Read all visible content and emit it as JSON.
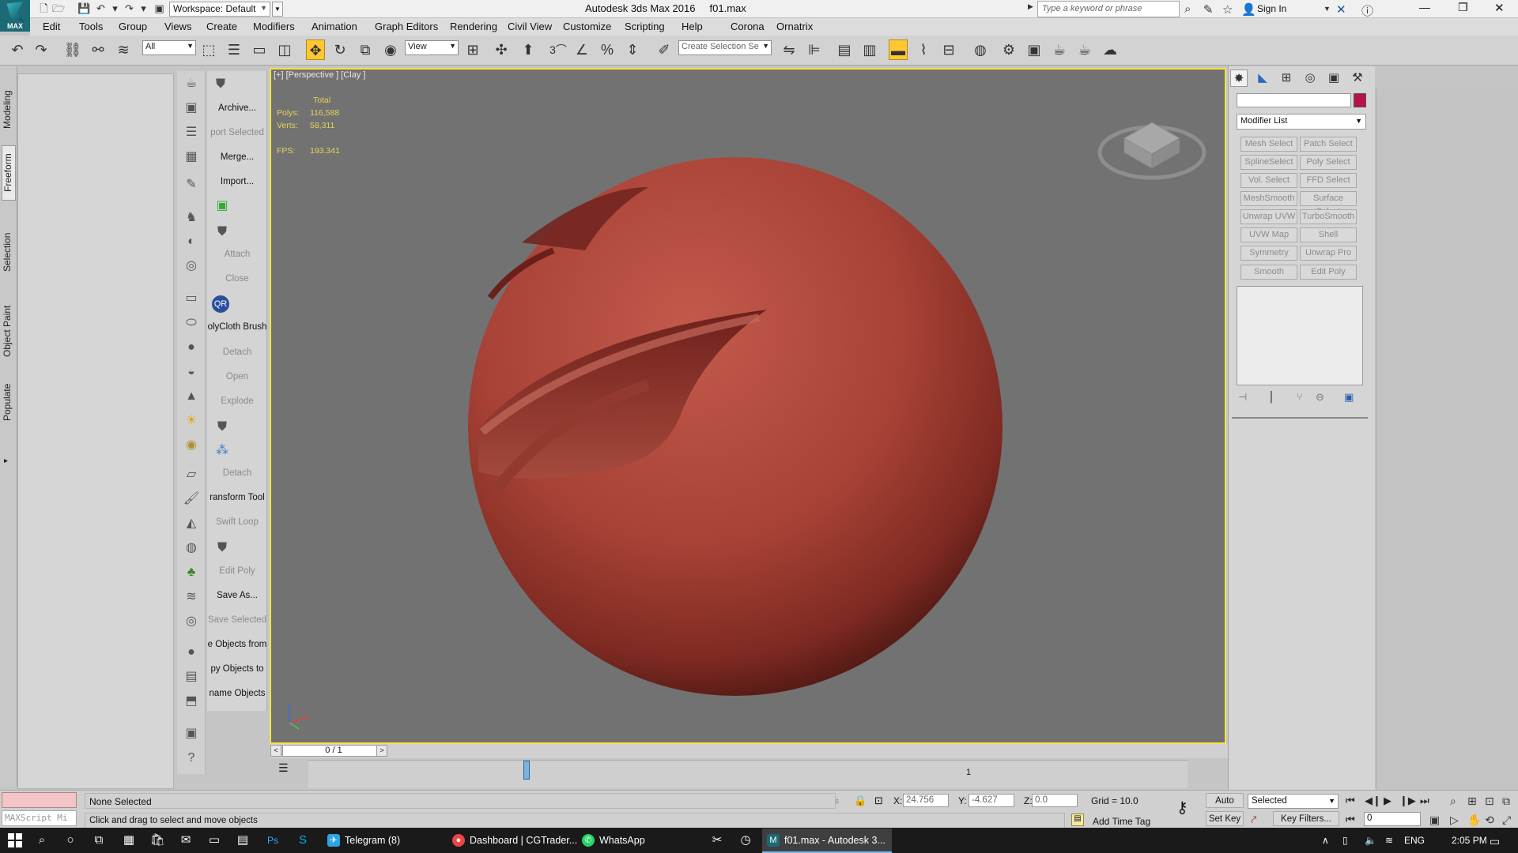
{
  "titlebar": {
    "logo_label": "MAX",
    "workspace": "Workspace: Default",
    "app_name": "Autodesk 3ds Max 2016",
    "file_name": "f01.max",
    "search_placeholder": "Type a keyword or phrase",
    "signin": "Sign In"
  },
  "menu": [
    "Edit",
    "Tools",
    "Group",
    "Views",
    "Create",
    "Modifiers",
    "Animation",
    "Graph Editors",
    "Rendering",
    "Civil View",
    "Customize",
    "Scripting",
    "Help",
    "Corona",
    "Ornatrix"
  ],
  "toolbar": {
    "filter": "All",
    "ref_coord": "View",
    "selection_set_placeholder": "Create Selection Se",
    "snap_label": "3"
  },
  "ribbon_tabs": [
    "Modeling",
    "Freeform",
    "Selection",
    "Object Paint",
    "Populate"
  ],
  "cmd_labels": [
    {
      "text": "Archive...",
      "enabled": true
    },
    {
      "text": "port Selected",
      "enabled": false
    },
    {
      "text": "Merge...",
      "enabled": true
    },
    {
      "text": "Import...",
      "enabled": true
    },
    {
      "text": "Attach",
      "enabled": false
    },
    {
      "text": "Close",
      "enabled": false
    },
    {
      "text": "olyCloth Brush",
      "enabled": true
    },
    {
      "text": "Detach",
      "enabled": false
    },
    {
      "text": "Open",
      "enabled": false
    },
    {
      "text": "Explode",
      "enabled": false
    },
    {
      "text": "Detach",
      "enabled": false
    },
    {
      "text": "ransform Tool",
      "enabled": true
    },
    {
      "text": "Swift Loop",
      "enabled": false
    },
    {
      "text": "Edit Poly",
      "enabled": false
    },
    {
      "text": "Save As...",
      "enabled": true
    },
    {
      "text": "Save Selected",
      "enabled": false
    },
    {
      "text": "e Objects from",
      "enabled": true
    },
    {
      "text": "py Objects to",
      "enabled": true
    },
    {
      "text": "name Objects",
      "enabled": true
    }
  ],
  "viewport": {
    "label": "[+] [Perspective ] [Clay ]",
    "stats_total": "Total",
    "polys_label": "Polys:",
    "polys": "116,588",
    "verts_label": "Verts:",
    "verts": "58,311",
    "fps_label": "FPS:",
    "fps": "193.341",
    "sphere_color": "#b04a3e"
  },
  "timeline": {
    "frame": "0 / 1",
    "track_tick": "1"
  },
  "command_panel": {
    "modifier_list": "Modifier List",
    "object_color": "#b8124a",
    "modifiers": [
      [
        "Mesh Select",
        "Patch Select"
      ],
      [
        "SplineSelect",
        "Poly Select"
      ],
      [
        "Vol. Select",
        "FFD Select"
      ],
      [
        "MeshSmooth",
        "Surface Select"
      ],
      [
        "Unwrap UVW",
        "TurboSmooth"
      ],
      [
        "UVW Map",
        "Shell"
      ],
      [
        "Symmetry",
        "Unwrap Pro"
      ],
      [
        "Smooth",
        "Edit Poly"
      ]
    ]
  },
  "status": {
    "selection": "None Selected",
    "prompt": "Click and drag to select and move objects",
    "maxscript": "MAXScript Mi",
    "x_label": "X:",
    "x": "24.756",
    "y_label": "Y:",
    "y": "-4.627",
    "z_label": "Z:",
    "z": "0.0",
    "grid": "Grid = 10.0",
    "add_time_tag": "Add Time Tag",
    "auto_key": "Auto Key",
    "set_key": "Set Key",
    "key_mode": "Selected",
    "key_filters": "Key Filters...",
    "frame_field": "0"
  },
  "taskbar": {
    "tasks": [
      "Telegram (8)",
      "Dashboard | CGTrader...",
      "WhatsApp",
      "f01.max - Autodesk 3..."
    ],
    "lang": "ENG",
    "time": "2:05 PM"
  }
}
